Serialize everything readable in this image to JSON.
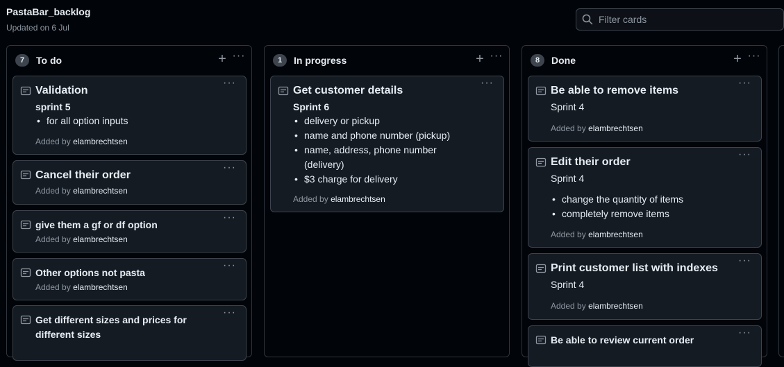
{
  "project": {
    "title": "PastaBar_backlog",
    "updated": "Updated on 6 Jul"
  },
  "filter": {
    "placeholder": "Filter cards"
  },
  "columns": [
    {
      "count": "7",
      "title": "To do",
      "cards": [
        {
          "title": "Validation",
          "sub": "sprint 5",
          "items": [
            "for all option inputs"
          ],
          "added_prefix": "Added by",
          "user": "elambrechtsen"
        },
        {
          "title": "Cancel their order",
          "added_prefix": "Added by",
          "user": "elambrechtsen"
        },
        {
          "title": "give them a gf or df option",
          "added_prefix": "Added by",
          "user": "elambrechtsen"
        },
        {
          "title": "Other options not pasta",
          "added_prefix": "Added by",
          "user": "elambrechtsen"
        },
        {
          "title": "Get different sizes and prices for",
          "title2": "different sizes"
        }
      ]
    },
    {
      "count": "1",
      "title": "In progress",
      "cards": [
        {
          "title": "Get customer details",
          "sub": "Sprint 6",
          "items": [
            "delivery or pickup",
            "name and phone number (pickup)",
            "name, address, phone number",
            "(delivery)",
            "$3 charge for delivery"
          ],
          "added_prefix": "Added by",
          "user": "elambrechtsen"
        }
      ]
    },
    {
      "count": "8",
      "title": "Done",
      "cards": [
        {
          "title": "Be able to remove items",
          "sub": "Sprint 4",
          "added_prefix": "Added by",
          "user": "elambrechtsen"
        },
        {
          "title": "Edit their order",
          "sub": "Sprint 4",
          "items": [
            "change the quantity of items",
            "completely remove items"
          ],
          "added_prefix": "Added by",
          "user": "elambrechtsen"
        },
        {
          "title": "Print customer list with indexes",
          "sub": "Sprint 4",
          "added_prefix": "Added by",
          "user": "elambrechtsen"
        },
        {
          "title": "Be able to review current order"
        }
      ]
    }
  ],
  "icons": {
    "search": "search-icon",
    "note": "note-icon",
    "plus": "plus-icon",
    "kebab": "kebab-icon"
  },
  "colors": {
    "background": "#010409",
    "card": "#151b23",
    "border": "#3d444d",
    "muted": "#8d96a0",
    "text": "#e6edf3"
  }
}
